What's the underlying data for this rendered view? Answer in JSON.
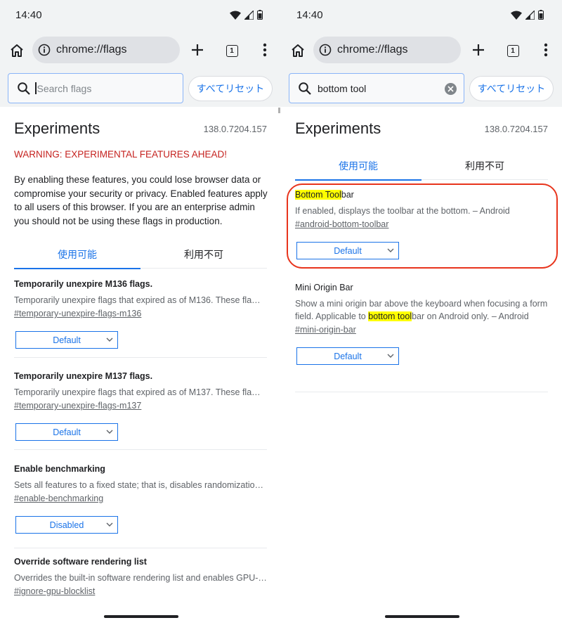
{
  "left": {
    "status": {
      "time": "14:40"
    },
    "toolbar": {
      "url": "chrome://flags",
      "tab_count": "1"
    },
    "search": {
      "value": "",
      "placeholder": "Search flags",
      "reset_label": "すべてリセット"
    },
    "header": {
      "title": "Experiments",
      "version": "138.0.7204.157"
    },
    "warning": "WARNING: EXPERIMENTAL FEATURES AHEAD!",
    "intro": "By enabling these features, you could lose browser data or compromise your security or privacy. Enabled features apply to all users of this browser. If you are an enterprise admin you should not be using these flags in production.",
    "tabs": [
      {
        "label": "使用可能"
      },
      {
        "label": "利用不可"
      }
    ],
    "flags": [
      {
        "name": "Temporarily unexpire M136 flags.",
        "desc": "Temporarily unexpire flags that expired as of M136. These fla…",
        "link": "#temporary-unexpire-flags-m136",
        "value": "Default"
      },
      {
        "name": "Temporarily unexpire M137 flags.",
        "desc": "Temporarily unexpire flags that expired as of M137. These fla…",
        "link": "#temporary-unexpire-flags-m137",
        "value": "Default"
      },
      {
        "name": "Enable benchmarking",
        "desc": "Sets all features to a fixed state; that is, disables randomizatio…",
        "link": "#enable-benchmarking",
        "value": "Disabled"
      },
      {
        "name": "Override software rendering list",
        "desc": "Overrides the built-in software rendering list and enables GPU-…",
        "link": "#ignore-gpu-blocklist"
      }
    ]
  },
  "right": {
    "status": {
      "time": "14:40"
    },
    "toolbar": {
      "url": "chrome://flags",
      "tab_count": "1"
    },
    "search": {
      "value": "bottom tool",
      "reset_label": "すべてリセット"
    },
    "header": {
      "title": "Experiments",
      "version": "138.0.7204.157"
    },
    "tabs": [
      {
        "label": "使用可能"
      },
      {
        "label": "利用不可"
      }
    ],
    "flags": [
      {
        "name_highlight": "Bottom Tool",
        "name_rest": "bar",
        "desc": "If enabled, displays the toolbar at the bottom. – Android",
        "link": "#android-bottom-toolbar",
        "value": "Default"
      },
      {
        "name": "Mini Origin Bar",
        "desc_before": "Show a mini origin bar above the keyboard when focusing a form field. Applicable to ",
        "desc_highlight": "bottom tool",
        "desc_after": "bar on Android only. – Android",
        "link": "#mini-origin-bar",
        "value": "Default"
      }
    ]
  },
  "colors": {
    "accent": "#1a73e8",
    "warning": "#c5221f",
    "highlight": "#ffff00",
    "annotation": "#e8341c"
  }
}
